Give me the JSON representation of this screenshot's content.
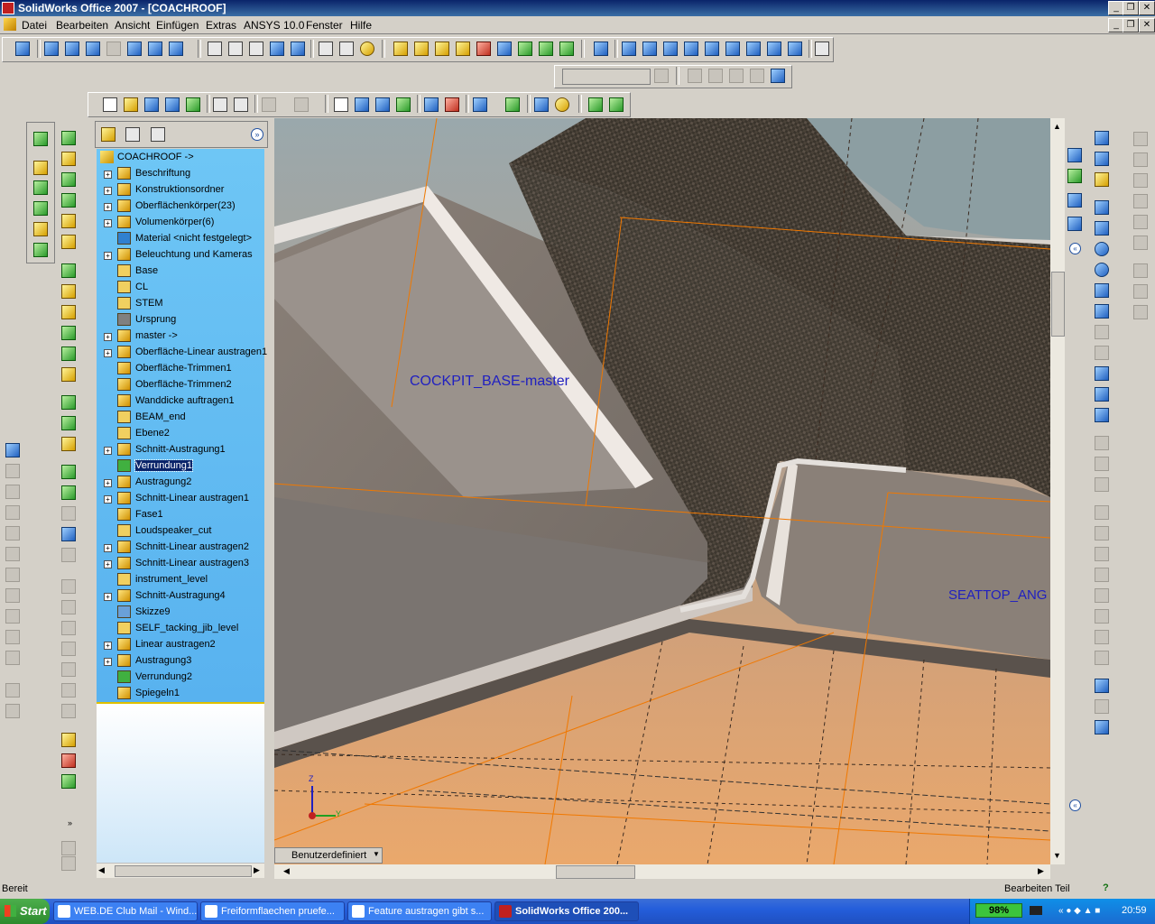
{
  "window": {
    "title": "SolidWorks Office 2007 - [COACHROOF]"
  },
  "menu": [
    "Datei",
    "Bearbeiten",
    "Ansicht",
    "Einfügen",
    "Extras",
    "ANSYS 10.0",
    "Fenster",
    "Hilfe"
  ],
  "tree": {
    "root": "COACHROOF ->",
    "items": [
      {
        "label": "Beschriftung",
        "expand": true,
        "icon": "annotation-icon"
      },
      {
        "label": "Konstruktionsordner",
        "expand": true,
        "icon": "design-folder-icon"
      },
      {
        "label": "Oberflächenkörper(23)",
        "expand": true,
        "icon": "surface-bodies-icon"
      },
      {
        "label": "Volumenkörper(6)",
        "expand": true,
        "icon": "solid-bodies-icon"
      },
      {
        "label": "Material <nicht festgelegt>",
        "expand": false,
        "icon": "material-icon"
      },
      {
        "label": "Beleuchtung und Kameras",
        "expand": true,
        "icon": "lights-icon"
      },
      {
        "label": "Base",
        "expand": false,
        "icon": "plane-icon"
      },
      {
        "label": "CL",
        "expand": false,
        "icon": "plane-icon"
      },
      {
        "label": "STEM",
        "expand": false,
        "icon": "plane-icon"
      },
      {
        "label": "Ursprung",
        "expand": false,
        "icon": "origin-icon"
      },
      {
        "label": "master ->",
        "expand": true,
        "icon": "derived-part-icon"
      },
      {
        "label": "Oberfläche-Linear austragen1",
        "expand": true,
        "icon": "surface-extrude-icon"
      },
      {
        "label": "Oberfläche-Trimmen1",
        "expand": false,
        "icon": "surface-trim-icon"
      },
      {
        "label": "Oberfläche-Trimmen2",
        "expand": false,
        "icon": "surface-trim-icon"
      },
      {
        "label": "Wanddicke auftragen1",
        "expand": false,
        "icon": "thicken-icon"
      },
      {
        "label": "BEAM_end",
        "expand": false,
        "icon": "plane-icon"
      },
      {
        "label": "Ebene2",
        "expand": false,
        "icon": "plane-icon"
      },
      {
        "label": "Schnitt-Austragung1",
        "expand": true,
        "icon": "cut-sweep-icon"
      },
      {
        "label": "Verrundung1",
        "expand": false,
        "icon": "fillet-icon",
        "selected": true
      },
      {
        "label": "Austragung2",
        "expand": true,
        "icon": "sweep-icon"
      },
      {
        "label": "Schnitt-Linear austragen1",
        "expand": true,
        "icon": "cut-extrude-icon"
      },
      {
        "label": "Fase1",
        "expand": false,
        "icon": "chamfer-icon"
      },
      {
        "label": "Loudspeaker_cut",
        "expand": false,
        "icon": "plane-icon"
      },
      {
        "label": "Schnitt-Linear austragen2",
        "expand": true,
        "icon": "cut-extrude-icon"
      },
      {
        "label": "Schnitt-Linear austragen3",
        "expand": true,
        "icon": "cut-extrude-icon"
      },
      {
        "label": "instrument_level",
        "expand": false,
        "icon": "plane-icon"
      },
      {
        "label": "Schnitt-Austragung4",
        "expand": true,
        "icon": "cut-sweep-icon"
      },
      {
        "label": "Skizze9",
        "expand": false,
        "icon": "sketch-icon"
      },
      {
        "label": "SELF_tacking_jib_level",
        "expand": false,
        "icon": "plane-icon"
      },
      {
        "label": "Linear austragen2",
        "expand": true,
        "icon": "extrude-icon"
      },
      {
        "label": "Austragung3",
        "expand": true,
        "icon": "sweep-icon"
      },
      {
        "label": "Verrundung2",
        "expand": false,
        "icon": "fillet-icon"
      },
      {
        "label": "Spiegeln1",
        "expand": false,
        "icon": "mirror-icon"
      }
    ]
  },
  "viewport": {
    "label_cockpit": "COCKPIT_BASE-master",
    "label_seat": "SEATTOP_ANG",
    "axis_z": "Z",
    "axis_y": "Y",
    "view_dropdown": "Benutzerdefiniert"
  },
  "statusbar": {
    "left": "Bereit",
    "right": "Bearbeiten Teil",
    "help": "?"
  },
  "taskbar": {
    "start": "Start",
    "tasks": [
      "WEB.DE Club Mail - Wind...",
      "Freiformflaechen pruefe...",
      "Feature austragen gibt s...",
      "SolidWorks Office 200..."
    ],
    "battery": "98%",
    "clock": "20:59"
  },
  "colors": {
    "tree_bg": "#6ec6f5",
    "viewport_bg": "#c9a583",
    "label_blue": "#2020c0",
    "guide_orange": "#f07800"
  }
}
